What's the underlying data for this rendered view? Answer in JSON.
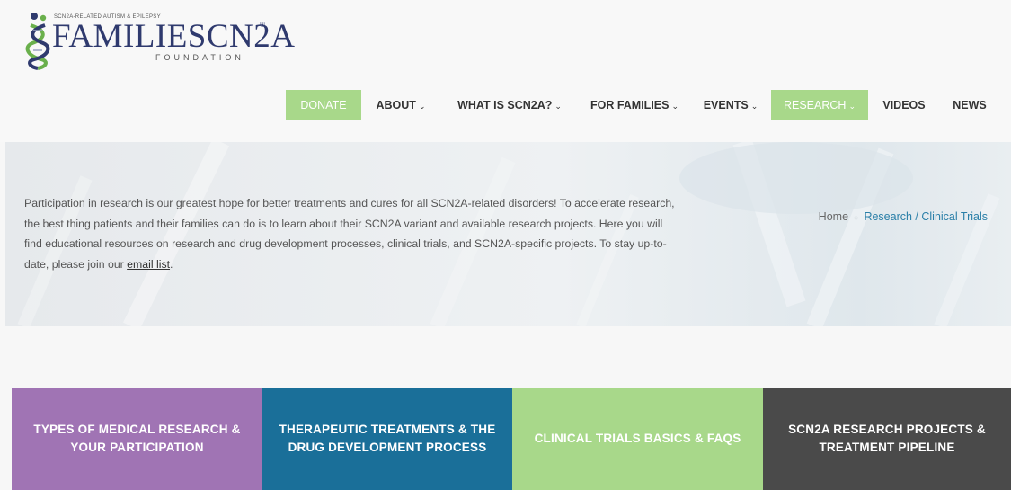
{
  "logo": {
    "tagline": "SCN2A-RELATED AUTISM & EPILEPSY",
    "wordmark": "FAMILIESCN2A",
    "registered": "®",
    "foundation": "FOUNDATION"
  },
  "nav": {
    "items": [
      {
        "label": "DONATE",
        "dropdown": false,
        "highlight": true
      },
      {
        "label": "ABOUT",
        "dropdown": true,
        "highlight": false
      },
      {
        "label": "WHAT IS SCN2A?",
        "dropdown": true,
        "highlight": false
      },
      {
        "label": "FOR FAMILIES",
        "dropdown": true,
        "highlight": false
      },
      {
        "label": "EVENTS",
        "dropdown": true,
        "highlight": false
      },
      {
        "label": "RESEARCH",
        "dropdown": true,
        "highlight": true
      },
      {
        "label": "VIDEOS",
        "dropdown": false,
        "highlight": false
      },
      {
        "label": "NEWS",
        "dropdown": false,
        "highlight": false
      }
    ],
    "chevron": "⌄"
  },
  "hero": {
    "text_before_link": "Participation in research is our greatest hope for better treatments and cures for all SCN2A-related disorders! To accelerate research, the best thing patients and their families can do is to learn about their SCN2A variant and available research projects. Here you will find educational resources on research and drug development processes, clinical trials, and SCN2A-specific projects. To stay up-to-date, please join our ",
    "link_text": "email list",
    "text_after_link": "."
  },
  "breadcrumb": {
    "home": "Home",
    "separator": "○",
    "current": "Research / Clinical Trials"
  },
  "tiles": [
    {
      "label": "TYPES OF MEDICAL RESEARCH & YOUR PARTICIPATION",
      "color": "#a074b4"
    },
    {
      "label": "THERAPEUTIC TREATMENTS & THE DRUG DEVELOPMENT PROCESS",
      "color": "#1a6f99"
    },
    {
      "label": "CLINICAL TRIALS BASICS & FAQS",
      "color": "#a8d88a"
    },
    {
      "label": "SCN2A RESEARCH PROJECTS & TREATMENT PIPELINE",
      "color": "#4a4a4a"
    }
  ],
  "colors": {
    "brand_navy": "#2f3a6e",
    "accent_green": "#a8d88a",
    "link_blue": "#2a7fa8"
  }
}
